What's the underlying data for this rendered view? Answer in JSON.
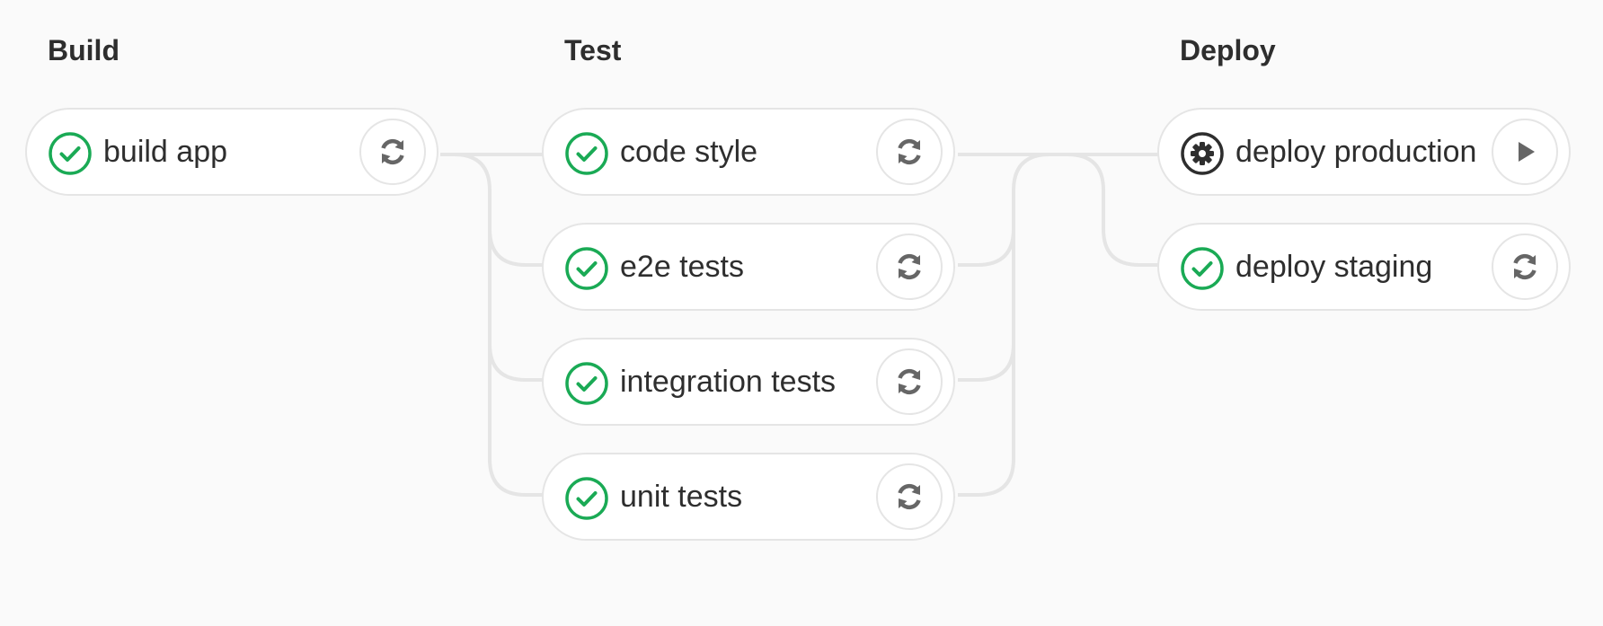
{
  "colors": {
    "success": "#1aaa55",
    "manual": "#2e2e2e",
    "connector": "#e5e5e5",
    "action_icon": "#666666"
  },
  "stages": [
    {
      "title": "Build",
      "jobs": [
        {
          "name": "build app",
          "status": "success",
          "status_icon": "check-circle-icon",
          "action": "retry",
          "action_icon": "retry-icon"
        }
      ]
    },
    {
      "title": "Test",
      "jobs": [
        {
          "name": "code style",
          "status": "success",
          "status_icon": "check-circle-icon",
          "action": "retry",
          "action_icon": "retry-icon"
        },
        {
          "name": "e2e tests",
          "status": "success",
          "status_icon": "check-circle-icon",
          "action": "retry",
          "action_icon": "retry-icon"
        },
        {
          "name": "integration tests",
          "status": "success",
          "status_icon": "check-circle-icon",
          "action": "retry",
          "action_icon": "retry-icon"
        },
        {
          "name": "unit tests",
          "status": "success",
          "status_icon": "check-circle-icon",
          "action": "retry",
          "action_icon": "retry-icon"
        }
      ]
    },
    {
      "title": "Deploy",
      "jobs": [
        {
          "name": "deploy production",
          "status": "manual",
          "status_icon": "gear-icon",
          "action": "play",
          "action_icon": "play-icon"
        },
        {
          "name": "deploy staging",
          "status": "success",
          "status_icon": "check-circle-icon",
          "action": "retry",
          "action_icon": "retry-icon"
        }
      ]
    }
  ]
}
